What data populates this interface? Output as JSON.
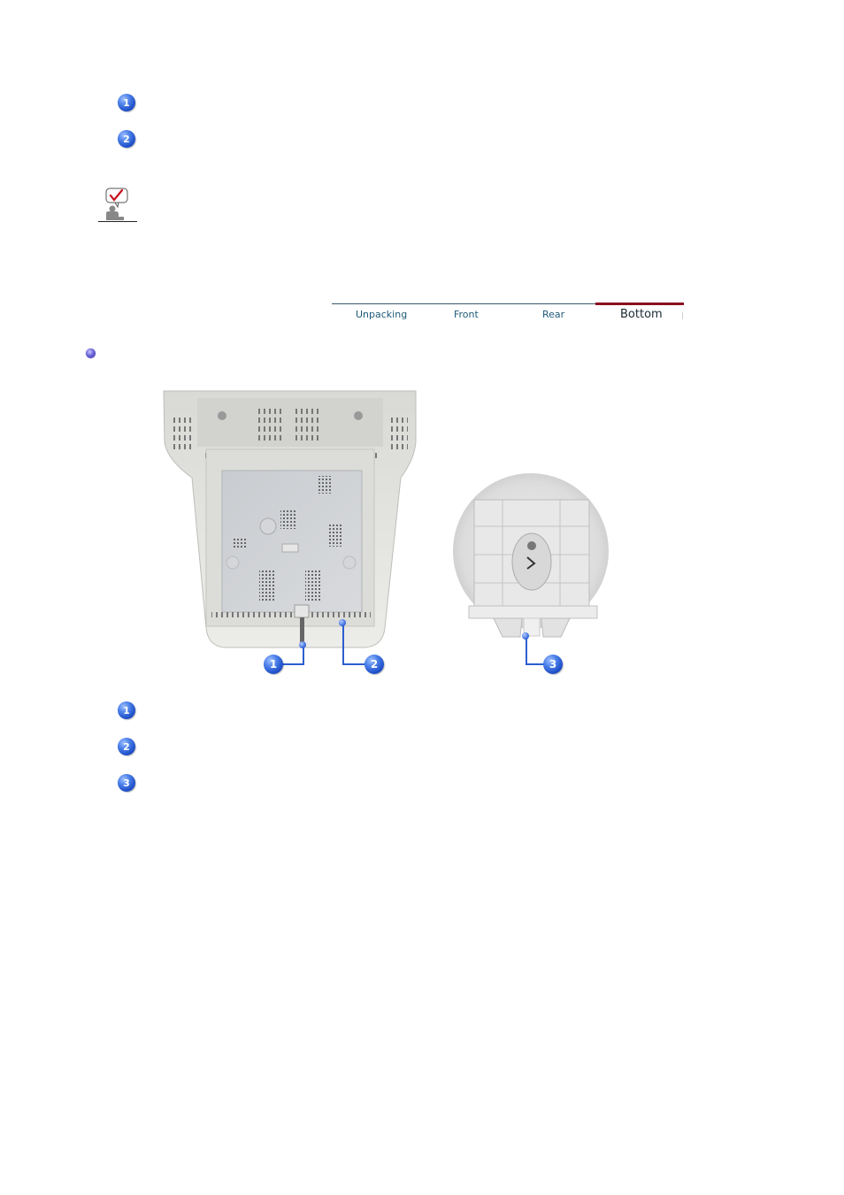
{
  "top_list": {
    "badges": [
      "1",
      "2"
    ]
  },
  "note": {
    "icon": "note-checkmark-person-icon"
  },
  "tabs": [
    {
      "label": "Unpacking",
      "active": false
    },
    {
      "label": "Front",
      "active": false
    },
    {
      "label": "Rear",
      "active": false
    },
    {
      "label": "Bottom",
      "active": true
    }
  ],
  "section": {
    "bullet_icon": "bullet-sphere-icon"
  },
  "figure": {
    "left_image": "monitor-bottom-view",
    "right_image": "monitor-stand-detail",
    "callouts": [
      "1",
      "2",
      "3"
    ]
  },
  "bottom_list": {
    "badges": [
      "1",
      "2",
      "3"
    ]
  },
  "colors": {
    "tab_active_line": "#8a0f1e",
    "tab_line": "#3a5a6a",
    "tab_text": "#1e5a7a",
    "badge_blue": "#2c5fd0"
  }
}
